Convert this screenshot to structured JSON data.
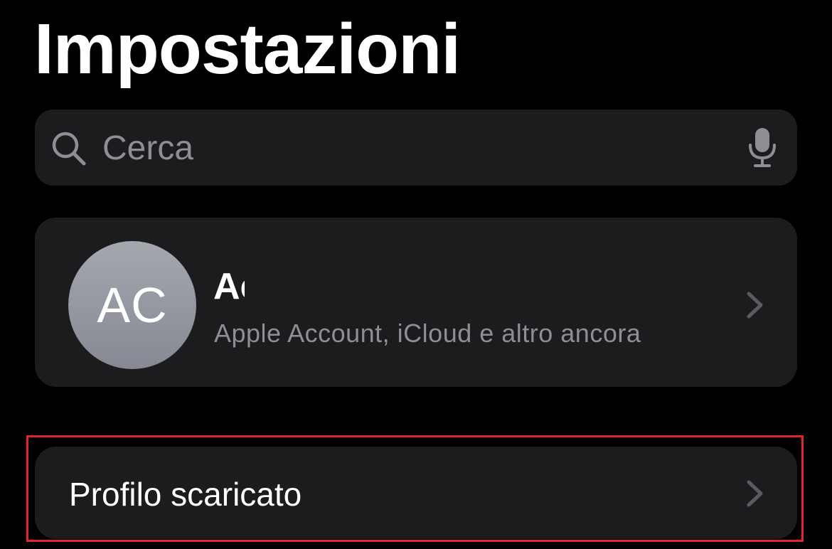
{
  "header": {
    "title": "Impostazioni"
  },
  "search": {
    "placeholder": "Cerca",
    "left_icon": "search-icon",
    "right_icon": "mic-icon"
  },
  "account": {
    "initials": "AC",
    "name": "Ac",
    "subtitle": "Apple Account, iCloud e altro ancora",
    "chevron_icon": "chevron-right-icon"
  },
  "profile_row": {
    "label": "Profilo scaricato",
    "chevron_icon": "chevron-right-icon",
    "highlighted": true
  },
  "colors": {
    "background": "#000000",
    "card": "#1c1c1e",
    "secondary_text": "#8e8e93",
    "highlight": "#e0262d"
  }
}
